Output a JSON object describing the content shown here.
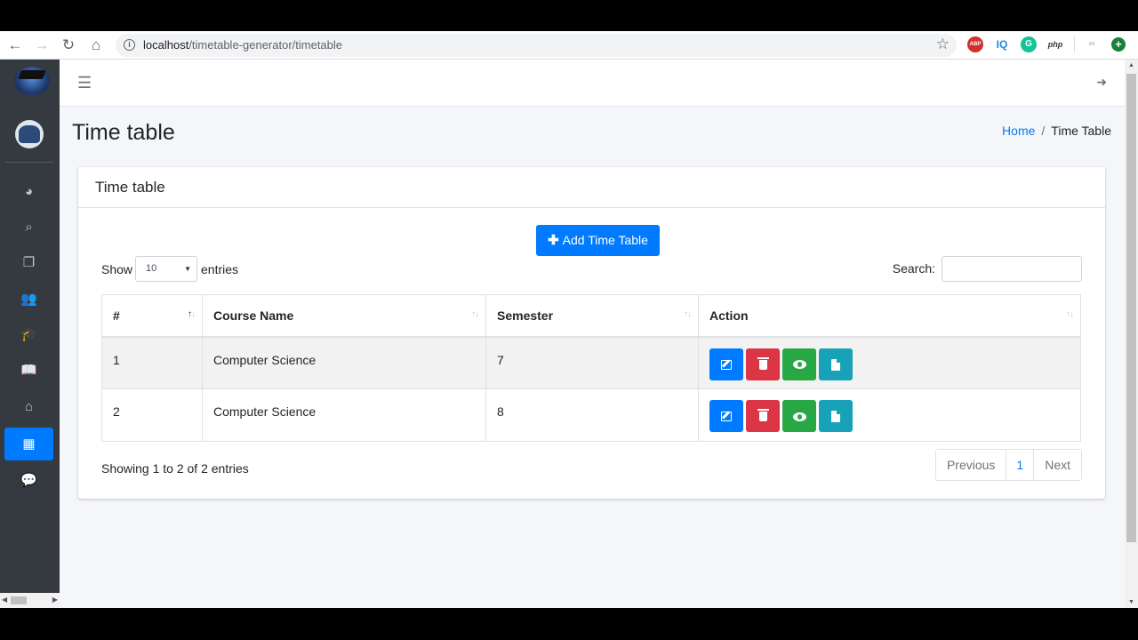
{
  "browser": {
    "url_host": "localhost",
    "url_path": "/timetable-generator/timetable",
    "extensions": [
      "ABP",
      "IQ",
      "G",
      "php"
    ]
  },
  "sidebar": {
    "items": [
      {
        "icon": "dashboard-icon",
        "glyph": "◕",
        "active": false
      },
      {
        "icon": "search-icon",
        "glyph": "⌕",
        "active": false
      },
      {
        "icon": "copy-icon",
        "glyph": "❐",
        "active": false
      },
      {
        "icon": "users-icon",
        "glyph": "👥",
        "active": false
      },
      {
        "icon": "graduation-cap-icon",
        "glyph": "🎓",
        "active": false
      },
      {
        "icon": "book-icon",
        "glyph": "📖",
        "active": false
      },
      {
        "icon": "home-icon",
        "glyph": "⌂",
        "active": false
      },
      {
        "icon": "table-icon",
        "glyph": "▦",
        "active": true
      },
      {
        "icon": "comment-icon",
        "glyph": "💬",
        "active": false
      }
    ]
  },
  "header": {
    "page_title": "Time table",
    "breadcrumb_home": "Home",
    "breadcrumb_sep": "/",
    "breadcrumb_current": "Time Table"
  },
  "card": {
    "title": "Time table",
    "add_button": "Add Time Table",
    "show_label": "Show",
    "entries_value": "10",
    "entries_label": "entries",
    "search_label": "Search:",
    "search_value": "",
    "columns": [
      "#",
      "Course Name",
      "Semester",
      "Action"
    ],
    "rows": [
      {
        "no": "1",
        "course": "Computer Science",
        "semester": "7"
      },
      {
        "no": "2",
        "course": "Computer Science",
        "semester": "8"
      }
    ],
    "info": "Showing 1 to 2 of 2 entries",
    "pagination": {
      "prev": "Previous",
      "page": "1",
      "next": "Next"
    }
  },
  "colors": {
    "primary": "#007bff",
    "danger": "#dc3545",
    "success": "#28a745",
    "info": "#17a2b8",
    "sidebar_bg": "#343a40"
  }
}
